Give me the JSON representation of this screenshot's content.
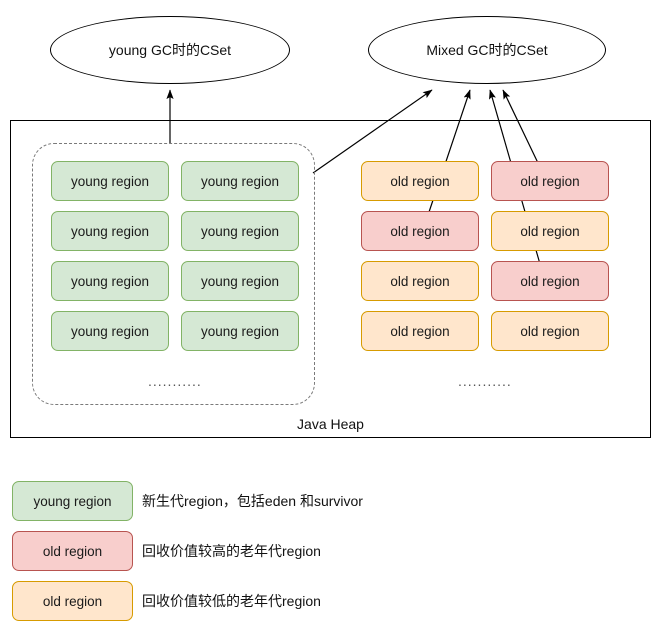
{
  "diagram": {
    "title_nodes": {
      "young_cset": "young GC时的CSet",
      "mixed_cset": "Mixed GC时的CSet"
    },
    "heap": {
      "label": "Java Heap",
      "young_group": {
        "ellipsis": "...........",
        "regions": [
          {
            "label": "young region",
            "kind": "young"
          },
          {
            "label": "young region",
            "kind": "young"
          },
          {
            "label": "young region",
            "kind": "young"
          },
          {
            "label": "young region",
            "kind": "young"
          },
          {
            "label": "young region",
            "kind": "young"
          },
          {
            "label": "young region",
            "kind": "young"
          },
          {
            "label": "young region",
            "kind": "young"
          },
          {
            "label": "young region",
            "kind": "young"
          }
        ]
      },
      "old_group": {
        "ellipsis": "...........",
        "regions": [
          {
            "label": "old region",
            "kind": "old-low"
          },
          {
            "label": "old region",
            "kind": "old-high"
          },
          {
            "label": "old region",
            "kind": "old-high"
          },
          {
            "label": "old region",
            "kind": "old-low"
          },
          {
            "label": "old region",
            "kind": "old-low"
          },
          {
            "label": "old region",
            "kind": "old-high"
          },
          {
            "label": "old region",
            "kind": "old-low"
          },
          {
            "label": "old region",
            "kind": "old-low"
          }
        ]
      }
    },
    "legend": [
      {
        "swatch_label": "young region",
        "kind": "young",
        "description": "新生代region，包括eden 和survivor"
      },
      {
        "swatch_label": "old region",
        "kind": "old-high",
        "description": "回收价值较高的老年代region"
      },
      {
        "swatch_label": "old region",
        "kind": "old-low",
        "description": "回收价值较低的老年代region"
      }
    ],
    "colors": {
      "young_fill": "#d5e8d4",
      "young_stroke": "#82b366",
      "old_low_fill": "#ffe6cc",
      "old_low_stroke": "#d79b00",
      "old_high_fill": "#f8cecc",
      "old_high_stroke": "#b85450",
      "edge": "#000000",
      "dashed_group": "#7a7a7a"
    }
  }
}
